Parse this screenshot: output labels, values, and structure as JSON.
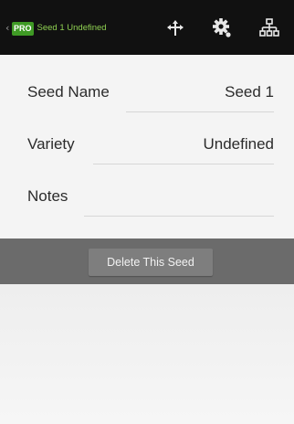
{
  "action_bar": {
    "badge": "PRO",
    "title": "Seed 1 Undefined",
    "up_caret": "‹",
    "icons": [
      "crosshair-move-icon",
      "gear-icon",
      "hierarchy-icon"
    ],
    "background": "#111111",
    "badge_color": "#3f9a25",
    "title_color": "#8fd052"
  },
  "form": {
    "seed_name": {
      "label": "Seed Name",
      "value": "Seed 1"
    },
    "variety": {
      "label": "Variety",
      "value": "Undefined"
    },
    "notes": {
      "label": "Notes",
      "value": ""
    }
  },
  "actions": {
    "delete_label": "Delete This Seed",
    "strip_color": "#6b6b6b"
  }
}
